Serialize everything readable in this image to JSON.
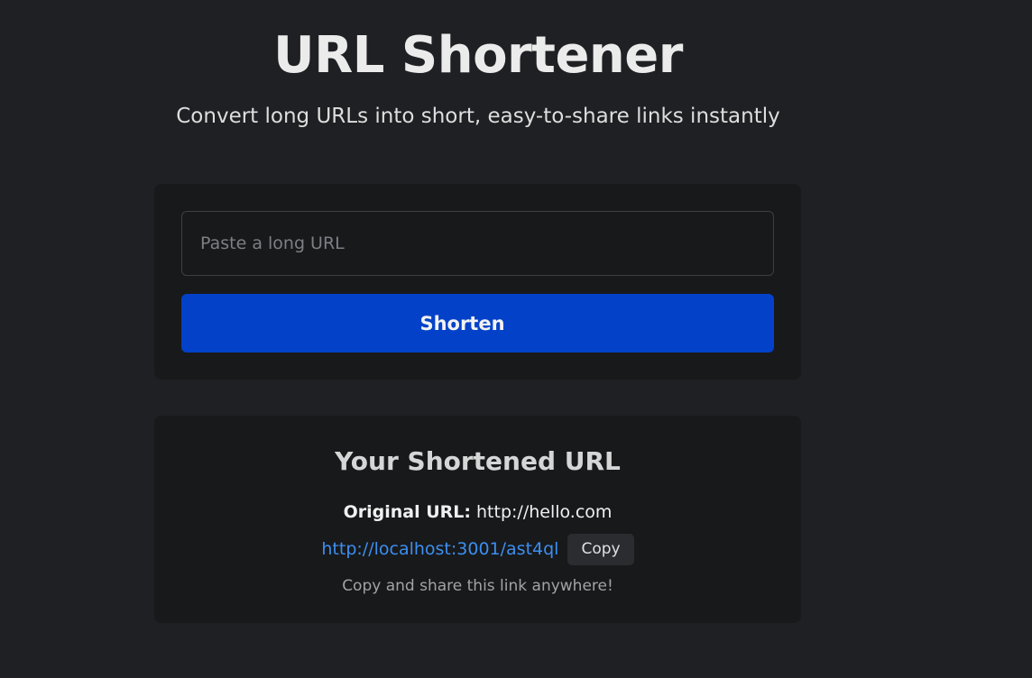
{
  "header": {
    "title": "URL Shortener",
    "subtitle": "Convert long URLs into short, easy-to-share links instantly"
  },
  "form": {
    "input_placeholder": "Paste a long URL",
    "input_value": "",
    "submit_label": "Shorten"
  },
  "result": {
    "heading": "Your Shortened URL",
    "original_label": "Original URL:",
    "original_value": "http://hello.com",
    "short_url": "http://localhost:3001/ast4ql",
    "copy_label": "Copy",
    "hint": "Copy and share this link anywhere!"
  },
  "colors": {
    "background": "#1f2023",
    "card": "#18191b",
    "accent_button": "#0342c8",
    "link": "#3c8ff0"
  }
}
